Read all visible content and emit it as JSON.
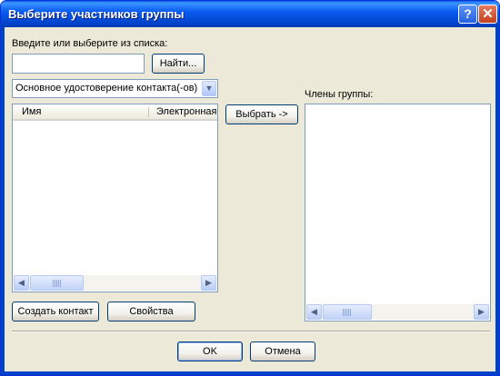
{
  "window": {
    "title": "Выберите участников группы",
    "help_glyph": "?",
    "close_glyph": "✕"
  },
  "search": {
    "label": "Введите или выберите из списка:",
    "value": "",
    "find_button": "Найти..."
  },
  "source_select": {
    "selected": "Основное удостоверение контакта(-ов)",
    "arrow_glyph": "▼"
  },
  "contacts_list": {
    "columns": [
      "Имя",
      "Электронная"
    ],
    "rows": []
  },
  "select_button": "Выбрать ->",
  "members": {
    "label": "Члены группы:",
    "items": []
  },
  "scroll": {
    "left_glyph": "◀",
    "right_glyph": "▶"
  },
  "actions": {
    "create_contact": "Создать контакт",
    "properties": "Свойства"
  },
  "footer": {
    "ok": "OK",
    "cancel": "Отмена"
  }
}
